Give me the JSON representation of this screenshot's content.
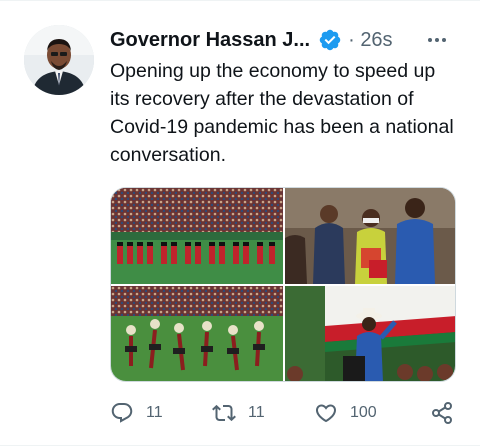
{
  "tweet": {
    "author_name": "Governor Hassan J...",
    "separator": "·",
    "time": "26s",
    "text": "Opening up the economy to speed up its recovery after the devastation of Covid-19 pandemic has been a national conversation."
  },
  "actions": {
    "replies": "11",
    "retweets": "11",
    "likes": "100"
  },
  "icons": {
    "verified": "verified-badge-icon",
    "more": "more-horizontal-icon",
    "reply": "reply-icon",
    "retweet": "retweet-icon",
    "like": "heart-icon",
    "share": "share-icon"
  },
  "colors": {
    "text": "#0f1419",
    "secondary": "#536471",
    "verified": "#1d9bf0",
    "border": "#eff3f4"
  }
}
